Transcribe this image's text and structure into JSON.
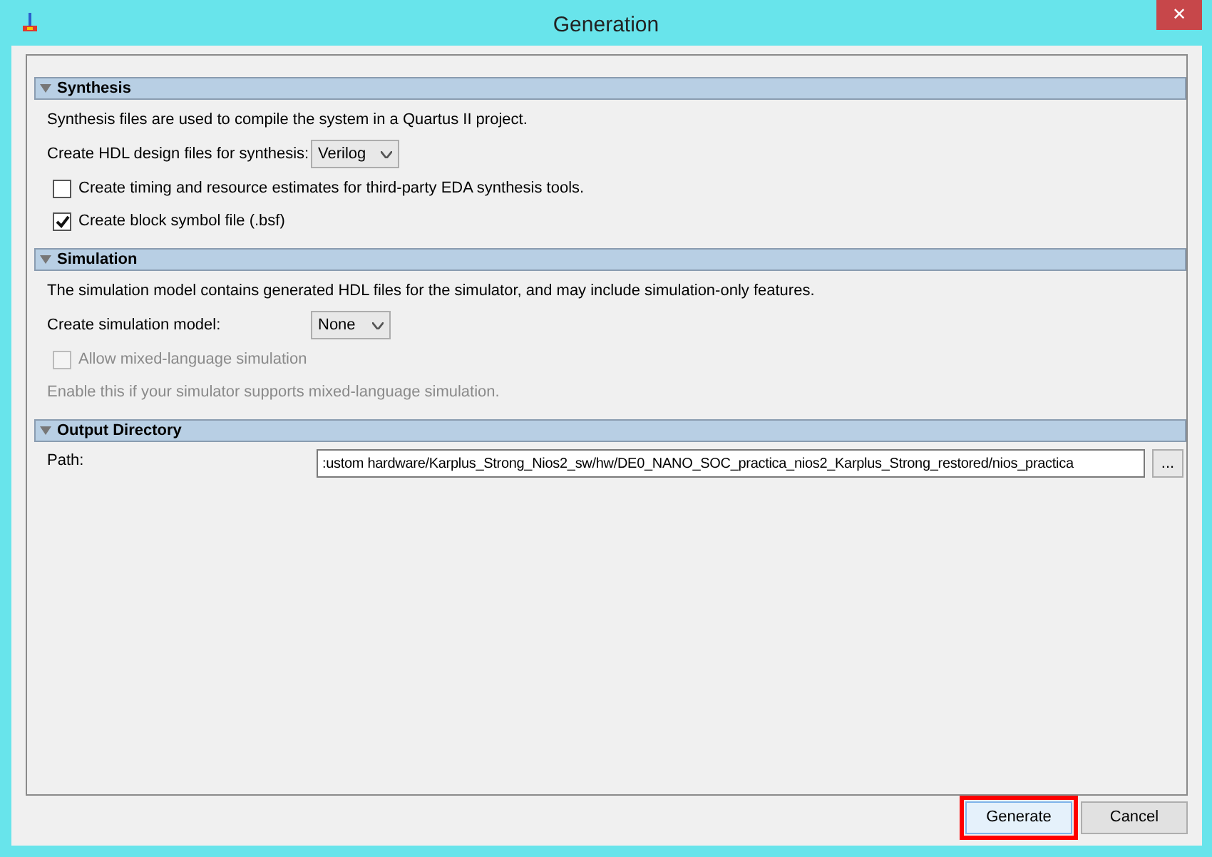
{
  "window": {
    "title": "Generation",
    "close": "✕"
  },
  "sections": [
    {
      "title": "Synthesis",
      "expanded": true,
      "items": [
        {
          "kind": "text",
          "text": "Synthesis files are used to compile the system in a Quartus II project.",
          "disabled": false
        },
        {
          "kind": "select",
          "label": "Create HDL design files for synthesis:",
          "value": "Verilog"
        },
        {
          "kind": "checkbox",
          "label": "Create timing and resource estimates for third-party EDA synthesis tools.",
          "checked": false,
          "disabled": false
        },
        {
          "kind": "checkbox",
          "label": "Create block symbol file (.bsf)",
          "checked": true,
          "disabled": false
        }
      ]
    },
    {
      "title": "Simulation",
      "expanded": true,
      "items": [
        {
          "kind": "text",
          "text": "The simulation model contains generated HDL files for the simulator, and may include simulation-only features.",
          "disabled": false
        },
        {
          "kind": "select",
          "label": "Create simulation model:",
          "value": "None"
        },
        {
          "kind": "checkbox",
          "label": "Allow mixed-language simulation",
          "checked": false,
          "disabled": true
        },
        {
          "kind": "text",
          "text": "Enable this if your simulator supports mixed-language simulation.",
          "disabled": true
        }
      ]
    },
    {
      "title": "Output Directory",
      "expanded": true,
      "items": [
        {
          "kind": "path",
          "label": "Path:",
          "value": ":ustom hardware/Karplus_Strong_Nios2_sw/hw/DE0_NANO_SOC_practica_nios2_Karplus_Strong_restored/nios_practica",
          "browse": "..."
        }
      ]
    }
  ],
  "buttons": [
    {
      "label": "Generate",
      "highlighted": true
    },
    {
      "label": "Cancel",
      "highlighted": false
    }
  ]
}
